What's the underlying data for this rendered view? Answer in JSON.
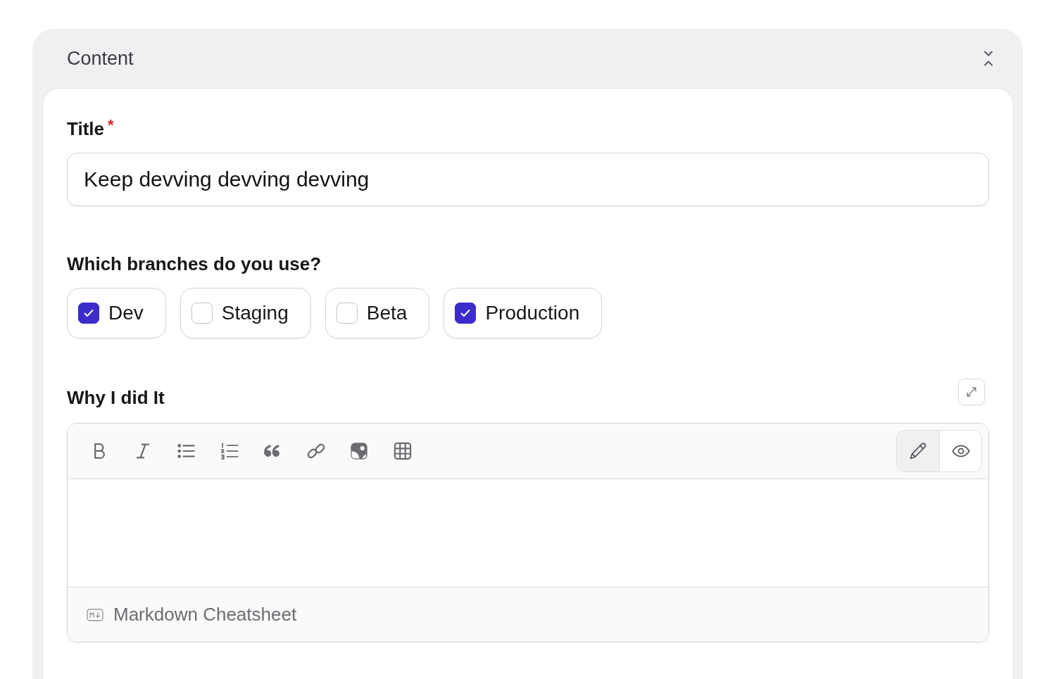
{
  "panel": {
    "title": "Content"
  },
  "title_field": {
    "label": "Title",
    "required": true,
    "required_mark": "*",
    "value": "Keep devving devving devving"
  },
  "branches": {
    "label": "Which branches do you use?",
    "options": [
      {
        "label": "Dev",
        "checked": true
      },
      {
        "label": "Staging",
        "checked": false
      },
      {
        "label": "Beta",
        "checked": false
      },
      {
        "label": "Production",
        "checked": true
      }
    ]
  },
  "editor": {
    "label": "Why I did It",
    "toolbar": [
      {
        "kind": "bold"
      },
      {
        "kind": "italic"
      },
      {
        "kind": "bullet-list"
      },
      {
        "kind": "numbered-list"
      },
      {
        "kind": "quote"
      },
      {
        "kind": "link"
      },
      {
        "kind": "image"
      },
      {
        "kind": "table"
      }
    ],
    "modes": [
      {
        "kind": "edit",
        "selected": true
      },
      {
        "kind": "preview",
        "selected": false
      }
    ],
    "footer_link": "Markdown Cheatsheet"
  }
}
